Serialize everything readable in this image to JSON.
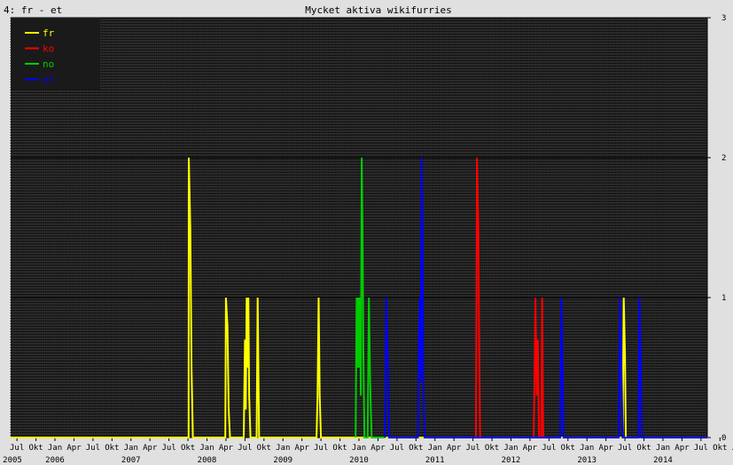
{
  "header": {
    "left_label": "4: fr - et",
    "title": "Mycket aktiva wikifurries"
  },
  "colors": {
    "background": "#e0e0e0",
    "plot_bg": "#2a2a2a",
    "grid": "#000000",
    "legend_bg": "#1a1a1a",
    "fr": "#ffff00",
    "ko": "#ff0000",
    "no": "#00cc00",
    "et": "#0000ff"
  },
  "chart_data": {
    "type": "line",
    "title": "Mycket aktiva wikifurries",
    "ylim": [
      0,
      3
    ],
    "y_ticks": [
      "0",
      "1",
      "2",
      "3"
    ],
    "x_start": "2005-06",
    "x_end": "2014-08",
    "month_labels": [
      "Jul",
      "Okt",
      "Jan",
      "Apr",
      "Jul",
      "Okt",
      "Jan",
      "Apr",
      "Jul",
      "Okt",
      "Jan",
      "Apr",
      "Jul",
      "Okt",
      "Jan",
      "Apr",
      "Jul",
      "Okt",
      "Jan",
      "Apr",
      "Jul",
      "Okt",
      "Jan",
      "Apr",
      "Jul",
      "Okt",
      "Jan",
      "Apr",
      "Jul",
      "Okt",
      "Jan",
      "Apr",
      "Jul",
      "Okt",
      "Jan",
      "Apr",
      "Jul",
      "Okt",
      "Jan",
      "Apr"
    ],
    "year_labels": [
      "2005",
      "2006",
      "2007",
      "2008",
      "2009",
      "2010",
      "2011",
      "2012",
      "2013",
      "2014"
    ],
    "legend_position": "top-left",
    "series": [
      {
        "name": "fr",
        "color": "#ffff00",
        "points": [
          [
            "2005-06-01",
            0
          ],
          [
            "2007-10-04",
            0
          ],
          [
            "2007-10-05",
            2
          ],
          [
            "2007-10-12",
            1.5
          ],
          [
            "2007-10-18",
            0.5
          ],
          [
            "2007-10-24",
            0
          ],
          [
            "2008-03-28",
            0
          ],
          [
            "2008-04-01",
            1
          ],
          [
            "2008-04-08",
            0.8
          ],
          [
            "2008-04-14",
            0.2
          ],
          [
            "2008-04-20",
            0
          ],
          [
            "2008-06-25",
            0
          ],
          [
            "2008-07-01",
            0.7
          ],
          [
            "2008-07-05",
            0.2
          ],
          [
            "2008-07-09",
            1
          ],
          [
            "2008-07-13",
            0.5
          ],
          [
            "2008-07-17",
            1
          ],
          [
            "2008-07-21",
            0.3
          ],
          [
            "2008-07-27",
            0
          ],
          [
            "2008-08-26",
            0
          ],
          [
            "2008-09-01",
            1
          ],
          [
            "2008-09-08",
            0
          ],
          [
            "2009-06-10",
            0
          ],
          [
            "2009-06-15",
            0.3
          ],
          [
            "2009-06-20",
            1
          ],
          [
            "2009-06-25",
            0.3
          ],
          [
            "2009-07-01",
            0
          ],
          [
            "2013-06-20",
            0
          ],
          [
            "2013-06-25",
            1
          ],
          [
            "2013-07-01",
            0.6
          ],
          [
            "2013-07-05",
            0
          ]
        ]
      },
      {
        "name": "ko",
        "color": "#ff0000",
        "points": [
          [
            "2011-07-15",
            0
          ],
          [
            "2011-07-20",
            2
          ],
          [
            "2011-07-26",
            1.5
          ],
          [
            "2011-08-01",
            0.5
          ],
          [
            "2011-08-05",
            0
          ],
          [
            "2012-04-18",
            0
          ],
          [
            "2012-04-22",
            0.3
          ],
          [
            "2012-04-27",
            1
          ],
          [
            "2012-05-03",
            0.3
          ],
          [
            "2012-05-08",
            0.7
          ],
          [
            "2012-05-14",
            0
          ],
          [
            "2012-05-24",
            0
          ],
          [
            "2012-05-29",
            1
          ],
          [
            "2012-06-04",
            0
          ]
        ]
      },
      {
        "name": "no",
        "color": "#00cc00",
        "points": [
          [
            "2009-12-15",
            0
          ],
          [
            "2009-12-20",
            1
          ],
          [
            "2009-12-24",
            0.5
          ],
          [
            "2009-12-28",
            1
          ],
          [
            "2010-01-02",
            0.5
          ],
          [
            "2010-01-06",
            1
          ],
          [
            "2010-01-10",
            0.3
          ],
          [
            "2010-01-14",
            2
          ],
          [
            "2010-01-18",
            1.5
          ],
          [
            "2010-01-22",
            0.6
          ],
          [
            "2010-01-27",
            0
          ],
          [
            "2010-02-12",
            0
          ],
          [
            "2010-02-18",
            1
          ],
          [
            "2010-02-24",
            0.4
          ],
          [
            "2010-03-01",
            0
          ],
          [
            "2010-05-05",
            0
          ]
        ]
      },
      {
        "name": "et",
        "color": "#0000ff",
        "points": [
          [
            "2010-05-05",
            0
          ],
          [
            "2010-05-10",
            1
          ],
          [
            "2010-05-18",
            0.5
          ],
          [
            "2010-05-24",
            0
          ],
          [
            "2010-10-10",
            0
          ],
          [
            "2010-10-15",
            0.7
          ],
          [
            "2010-10-20",
            1
          ],
          [
            "2010-10-24",
            0.4
          ],
          [
            "2010-10-28",
            2
          ],
          [
            "2010-11-02",
            1.5
          ],
          [
            "2010-11-06",
            0.4
          ],
          [
            "2010-11-12",
            0
          ],
          [
            "2012-08-24",
            0
          ],
          [
            "2012-08-30",
            1
          ],
          [
            "2012-09-05",
            0.5
          ],
          [
            "2012-09-10",
            0
          ],
          [
            "2013-06-01",
            0
          ],
          [
            "2013-06-08",
            1
          ],
          [
            "2013-06-14",
            0.5
          ],
          [
            "2013-06-20",
            0
          ],
          [
            "2013-09-05",
            0
          ],
          [
            "2013-09-10",
            1
          ],
          [
            "2013-09-16",
            0.5
          ],
          [
            "2013-09-22",
            0
          ],
          [
            "2014-08-01",
            0
          ]
        ]
      }
    ]
  }
}
